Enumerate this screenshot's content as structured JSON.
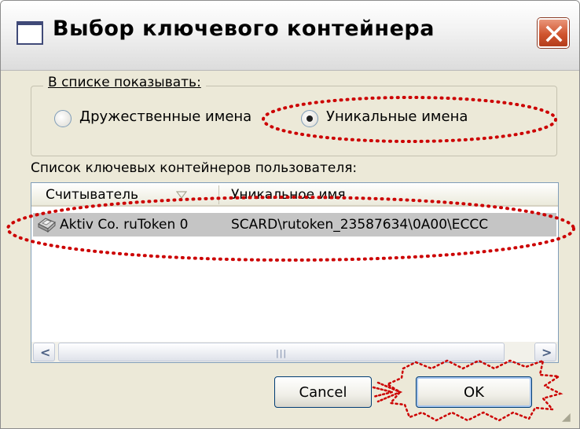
{
  "window": {
    "title": "Выбор ключевого контейнера"
  },
  "group": {
    "legend": "В списке показывать:",
    "options": [
      {
        "label": "Дружественные имена",
        "checked": false
      },
      {
        "label": "Уникальные имена",
        "checked": true
      }
    ]
  },
  "list": {
    "caption": "Список ключевых контейнеров пользователя:",
    "columns": [
      "Считыватель",
      "Уникальное имя"
    ],
    "rows": [
      {
        "reader": "Aktiv Co. ruToken 0",
        "unique_name": "SCARD\\rutoken_23587634\\0A00\\ECCC",
        "selected": true
      }
    ]
  },
  "buttons": {
    "cancel": "Cancel",
    "ok": "OK"
  },
  "colors": {
    "annotation": "#cc0000",
    "selection": "#c5c5c5",
    "dialog_bg": "#ece9d8"
  },
  "icons": {
    "window": "window-icon",
    "close": "close-icon",
    "sort": "sort-desc-icon",
    "token": "smartcard-reader-icon"
  }
}
